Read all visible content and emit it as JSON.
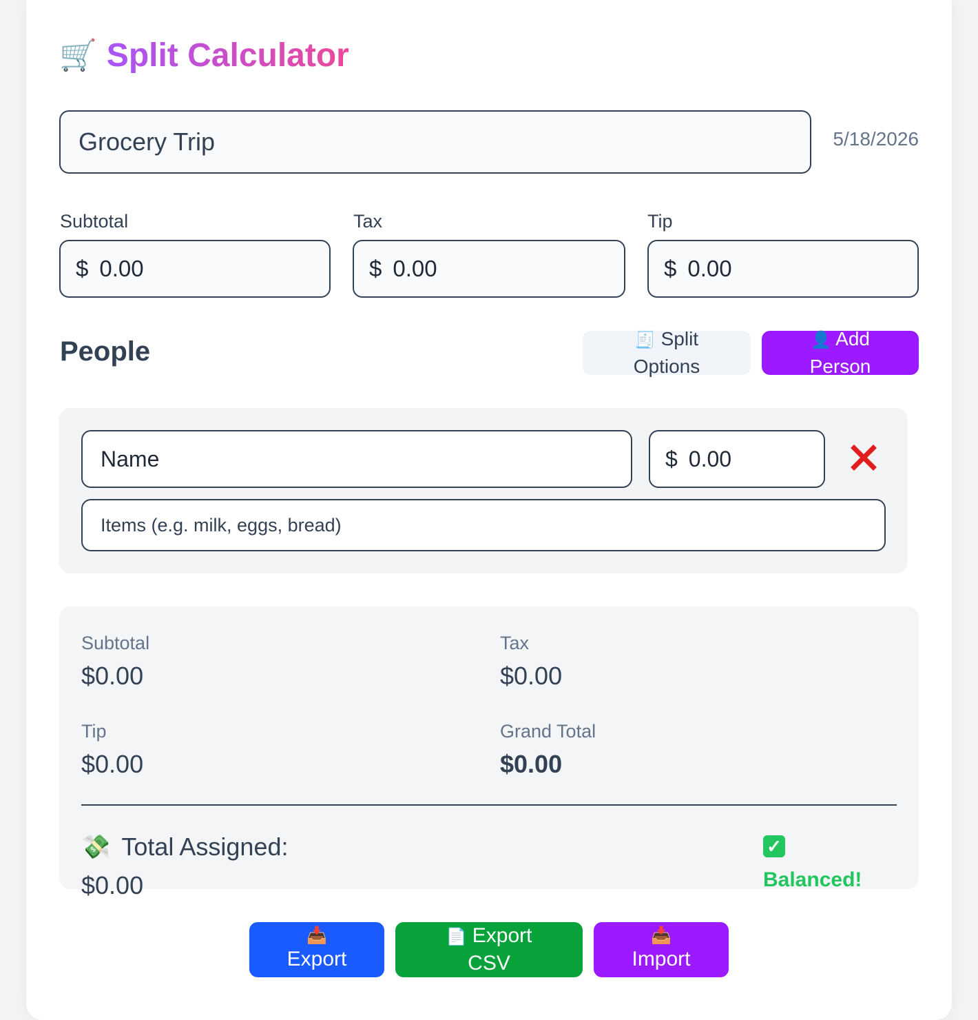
{
  "app": {
    "title_icon": "shopping-cart-icon",
    "title": "Split Calculator"
  },
  "trip": {
    "name": "Grocery Trip",
    "date": "5/18/2026"
  },
  "bill": {
    "currency": "$",
    "subtotal_label": "Subtotal",
    "subtotal_value": "0.00",
    "tax_label": "Tax",
    "tax_value": "0.00",
    "tip_label": "Tip",
    "tip_value": "0.00"
  },
  "people": {
    "heading": "People",
    "split_options": {
      "icon": "receipt-icon",
      "label_line1": "Split",
      "label_line2": "Options"
    },
    "add_person": {
      "icon": "person-icon",
      "label_line1": "Add",
      "label_line2": "Person"
    },
    "rows": [
      {
        "name_placeholder": "Name",
        "amount_placeholder": "0.00",
        "items_placeholder": "Items (e.g. milk, eggs, bread)",
        "delete_icon": "close-icon"
      }
    ]
  },
  "summary": {
    "subtotal_label": "Subtotal",
    "subtotal_value": "$0.00",
    "tax_label": "Tax",
    "tax_value": "$0.00",
    "tip_label": "Tip",
    "tip_value": "$0.00",
    "grand_total_label": "Grand Total",
    "grand_total_value": "$0.00",
    "assigned_icon": "money-with-wings-icon",
    "assigned_label": "Total Assigned:",
    "assigned_value": "$0.00",
    "status_icon": "check-mark-icon",
    "status_text": "Balanced!"
  },
  "actions": {
    "export": {
      "icon": "inbox-tray-icon",
      "label": "Export"
    },
    "export_csv": {
      "icon": "document-icon",
      "label_line1": "Export",
      "label_line2": "CSV"
    },
    "import": {
      "icon": "inbox-tray-icon",
      "label": "Import"
    }
  },
  "colors": {
    "title_gradient_start": "#a855f7",
    "title_gradient_end": "#ec4899",
    "add_person_bg": "#9b1aff",
    "export_bg": "#1a5bff",
    "export_csv_bg": "#07a33a",
    "import_bg": "#9b1aff",
    "delete_icon": "#e11d1d",
    "balanced": "#22c55e"
  }
}
